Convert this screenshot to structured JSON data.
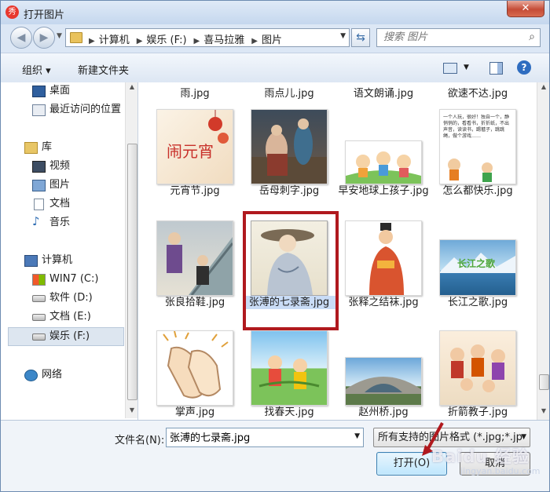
{
  "window": {
    "title": "打开图片",
    "close_label": "✕"
  },
  "address": {
    "crumbs": [
      "计算机",
      "娱乐 (F:)",
      "喜马拉雅",
      "图片"
    ]
  },
  "search": {
    "placeholder": "搜索 图片"
  },
  "toolbar": {
    "organize_label": "组织 ▾",
    "new_folder_label": "新建文件夹",
    "help_label": "?"
  },
  "sidebar": {
    "items": [
      {
        "label": "桌面",
        "icon": "desktop-icon"
      },
      {
        "label": "最近访问的位置",
        "icon": "recent-places-icon"
      },
      {
        "label": "库",
        "icon": "library-icon"
      },
      {
        "label": "视频",
        "icon": "video-icon"
      },
      {
        "label": "图片",
        "icon": "pictures-icon"
      },
      {
        "label": "文档",
        "icon": "documents-icon"
      },
      {
        "label": "音乐",
        "icon": "music-icon"
      },
      {
        "label": "计算机",
        "icon": "computer-icon"
      },
      {
        "label": "WIN7 (C:)",
        "icon": "system-drive-icon"
      },
      {
        "label": "软件 (D:)",
        "icon": "drive-icon"
      },
      {
        "label": "文档 (E:)",
        "icon": "drive-icon"
      },
      {
        "label": "娱乐 (F:)",
        "icon": "drive-icon",
        "selected": true
      },
      {
        "label": "网络",
        "icon": "network-icon"
      }
    ]
  },
  "files": [
    {
      "name": "雨.jpg"
    },
    {
      "name": "雨点儿.jpg"
    },
    {
      "name": "语文朗诵.jpg"
    },
    {
      "name": "欲速不达.jpg"
    },
    {
      "name": "元宵节.jpg",
      "thumb_text": "闹元宵"
    },
    {
      "name": "岳母刺字.jpg"
    },
    {
      "name": "早安地球上孩子.jpg"
    },
    {
      "name": "怎么都快乐.jpg",
      "thumb_text": "一个人玩，很好！独自一个，静悄悄的，看看书，折折纸，不出声音，读读书，踢毽子，跳跳绳，做个游戏……"
    },
    {
      "name": "张良拾鞋.jpg"
    },
    {
      "name": "张溥的七录斋.jpg",
      "selected": true
    },
    {
      "name": "张释之结袜.jpg"
    },
    {
      "name": "长江之歌.jpg",
      "thumb_text": "长江之歌"
    },
    {
      "name": "掌声.jpg"
    },
    {
      "name": "找春天.jpg"
    },
    {
      "name": "赵州桥.jpg"
    },
    {
      "name": "折箭教子.jpg"
    }
  ],
  "bottom": {
    "filename_label": "文件名(N):",
    "filename_value": "张溥的七录斋.jpg",
    "filter_label": "所有支持的图片格式 (*.jpg;*.jp",
    "open_label": "打开(O)",
    "cancel_label": "取消"
  },
  "watermark": {
    "text": "Baidu 经验",
    "sub": "jingyan.baidu.com"
  },
  "colors": {
    "selection_box": "#b0191e",
    "window_frame": "#dce7f5",
    "close_button": "#c54c37"
  }
}
